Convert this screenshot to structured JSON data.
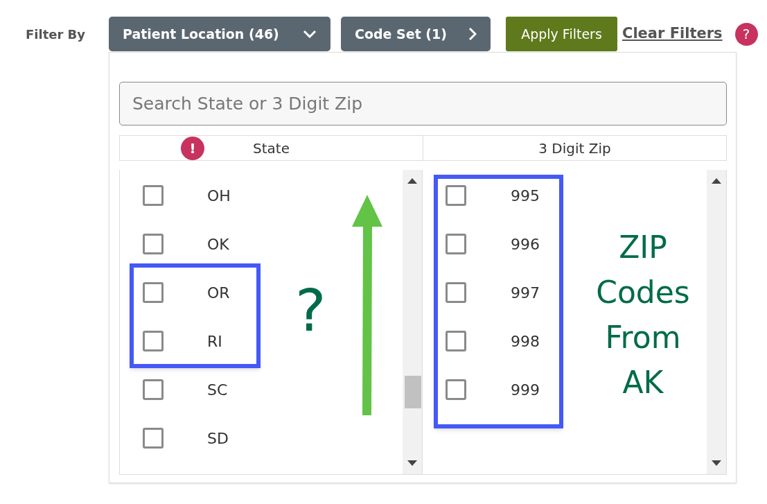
{
  "filter_label": "Filter By",
  "filter_buttons": [
    {
      "label": "Patient Location (46)",
      "kind": "dropdown"
    },
    {
      "label": "Code Set (1)",
      "kind": "submenu"
    }
  ],
  "apply_button": "Apply Filters",
  "clear_link": "Clear Filters",
  "help": "?",
  "search": {
    "placeholder": "Search State or 3 Digit Zip"
  },
  "columns": [
    {
      "label": "State",
      "alert": "!"
    },
    {
      "label": "3 Digit Zip"
    }
  ],
  "state_list": [
    {
      "label": "OH",
      "checked": false
    },
    {
      "label": "OK",
      "checked": false
    },
    {
      "label": "OR",
      "checked": false
    },
    {
      "label": "RI",
      "checked": false
    },
    {
      "label": "SC",
      "checked": false
    },
    {
      "label": "SD",
      "checked": false
    }
  ],
  "zip_list": [
    {
      "label": "995",
      "checked": false
    },
    {
      "label": "996",
      "checked": false
    },
    {
      "label": "997",
      "checked": false
    },
    {
      "label": "998",
      "checked": false
    },
    {
      "label": "999",
      "checked": false
    }
  ],
  "annotations": {
    "question_mark": "?",
    "note_lines": [
      "ZIP",
      "Codes",
      "From",
      "AK"
    ]
  }
}
